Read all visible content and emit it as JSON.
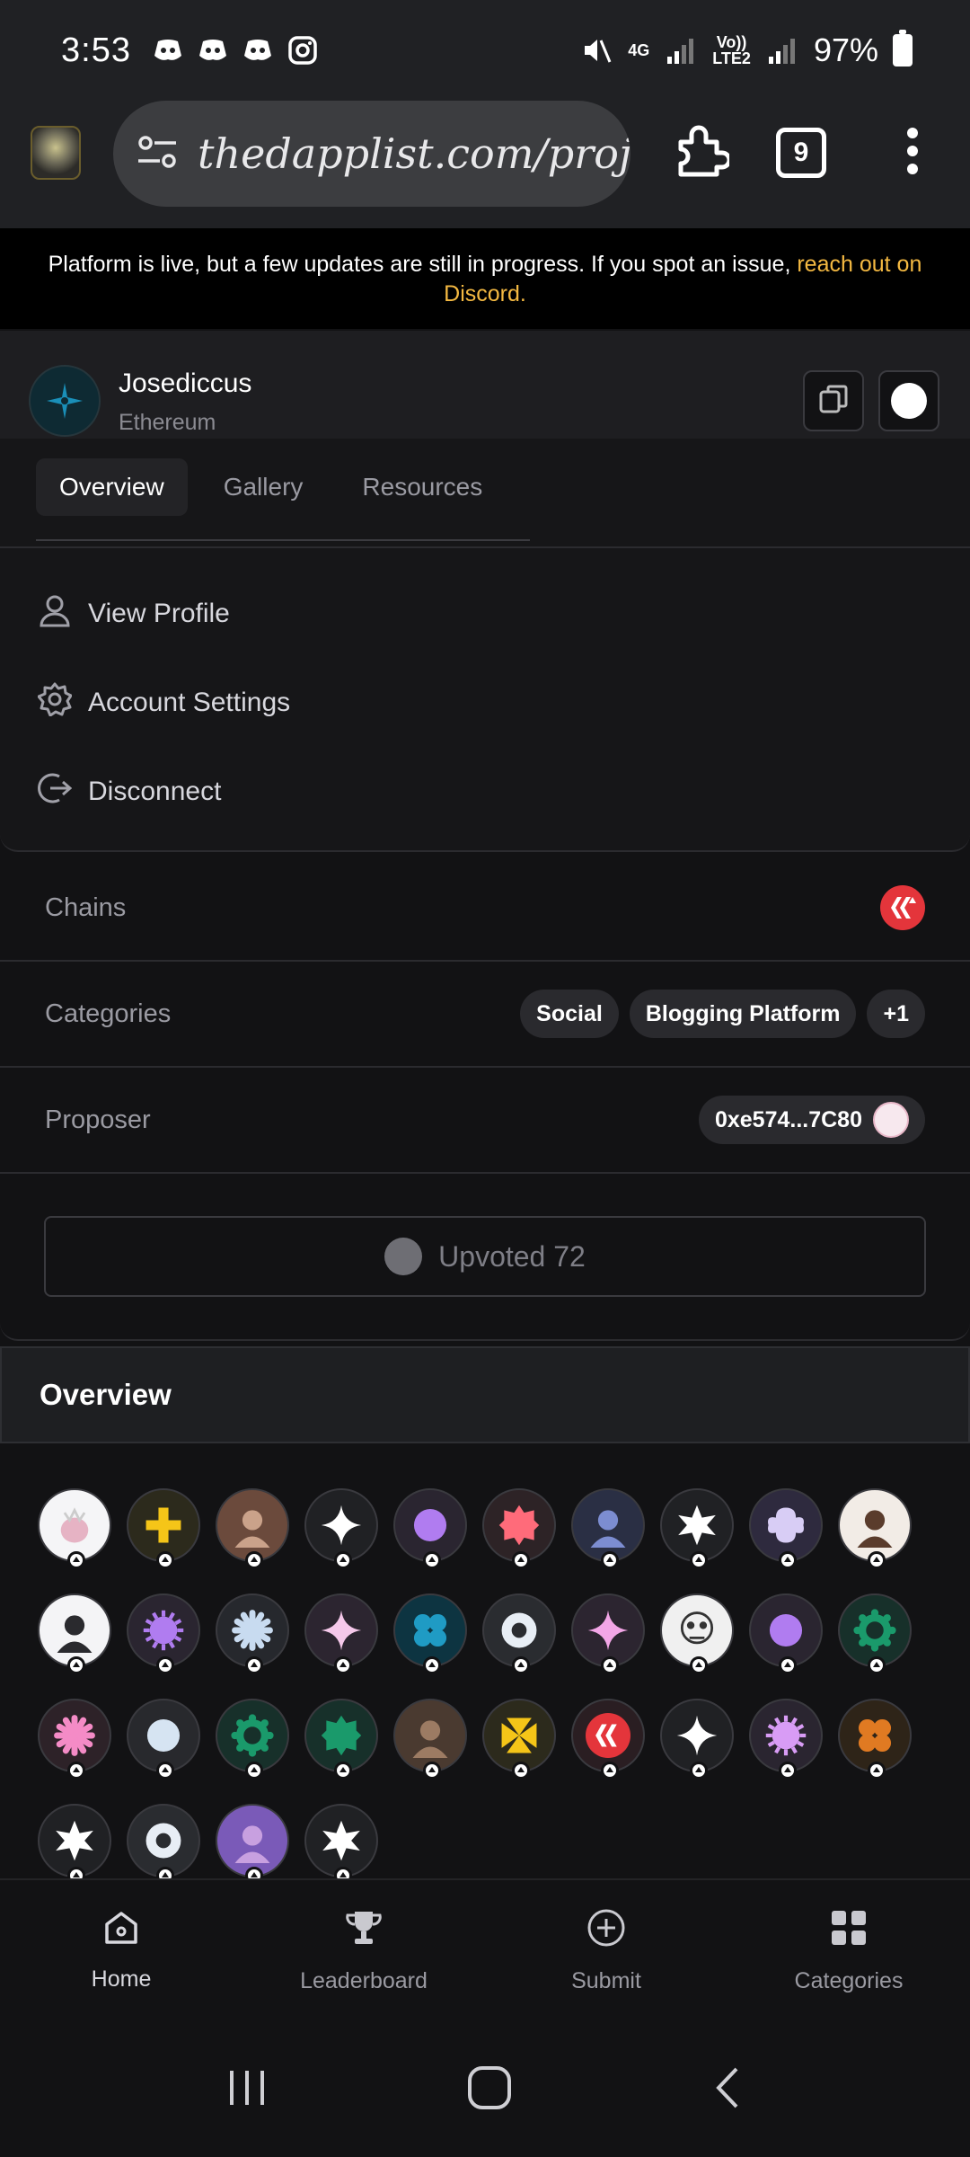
{
  "status_bar": {
    "time": "3:53",
    "network_top": "4G",
    "volte_label": "Vo))\nLTE2",
    "battery": "97%"
  },
  "browser": {
    "url": "thedapplist.com/projeс",
    "tab_count": "9"
  },
  "banner": {
    "text": "Platform is live, but a few updates are still in progress. If you spot an issue, ",
    "link": "reach out on Discord."
  },
  "profile": {
    "name": "Josediccus",
    "chain": "Ethereum",
    "tabs": [
      "Overview",
      "Gallery",
      "Resources"
    ],
    "menu": [
      "View Profile",
      "Account Settings",
      "Disconnect"
    ]
  },
  "details": {
    "chains_label": "Chains",
    "categories_label": "Categories",
    "categories": [
      "Social",
      "Blogging Platform",
      "+1"
    ],
    "proposer_label": "Proposer",
    "proposer_address": "0xe574...7C80",
    "upvote_label": "Upvoted 72"
  },
  "overview": {
    "title": "Overview",
    "voters": [
      {
        "bg": "#f5f5f7",
        "fg": "#e6b3c4",
        "shape": "creature"
      },
      {
        "bg": "#2c2a1c",
        "fg": "#f5c518",
        "shape": "plus"
      },
      {
        "bg": "#6b4a3c",
        "fg": "#caa28a",
        "shape": "photo"
      },
      {
        "bg": "#202124",
        "fg": "#ffffff",
        "shape": "star4"
      },
      {
        "bg": "#2a2530",
        "fg": "#b07cf0",
        "shape": "flower"
      },
      {
        "bg": "#2d2326",
        "fg": "#ff6b7a",
        "shape": "burst"
      },
      {
        "bg": "#2a2f44",
        "fg": "#7c8dd1",
        "shape": "photo"
      },
      {
        "bg": "#202124",
        "fg": "#ffffff",
        "shape": "star6"
      },
      {
        "bg": "#2e2a3e",
        "fg": "#d8cdf5",
        "shape": "petal"
      },
      {
        "bg": "#f2ece6",
        "fg": "#5a3c2c",
        "shape": "photo"
      },
      {
        "bg": "#f4f4f6",
        "fg": "#2a2a2e",
        "shape": "photo"
      },
      {
        "bg": "#2a2530",
        "fg": "#b07cf0",
        "shape": "sun"
      },
      {
        "bg": "#26282d",
        "fg": "#c8dbf0",
        "shape": "asterisk"
      },
      {
        "bg": "#2c2530",
        "fg": "#f5c8ea",
        "shape": "star4"
      },
      {
        "bg": "#0d3441",
        "fg": "#1f9bc4",
        "shape": "clover"
      },
      {
        "bg": "#2a2c30",
        "fg": "#e8eef5",
        "shape": "ring"
      },
      {
        "bg": "#2c2530",
        "fg": "#f2a6e6",
        "shape": "star4"
      },
      {
        "bg": "#f0f0f0",
        "fg": "#333333",
        "shape": "sketch"
      },
      {
        "bg": "#2a2530",
        "fg": "#b07cf0",
        "shape": "flower"
      },
      {
        "bg": "#17302a",
        "fg": "#1a9a6b",
        "shape": "gear"
      },
      {
        "bg": "#2d2228",
        "fg": "#f48bc6",
        "shape": "asterisk"
      },
      {
        "bg": "#28292d",
        "fg": "#d6e4f2",
        "shape": "flower"
      },
      {
        "bg": "#17302a",
        "fg": "#1a9a6b",
        "shape": "gear"
      },
      {
        "bg": "#17302a",
        "fg": "#1a9a6b",
        "shape": "burst"
      },
      {
        "bg": "#4a3a30",
        "fg": "#9c7b63",
        "shape": "photo"
      },
      {
        "bg": "#2c2a1c",
        "fg": "#f5c518",
        "shape": "pinwheel"
      },
      {
        "bg": "#2a1e22",
        "fg": "#e4353b",
        "shape": "hive"
      },
      {
        "bg": "#202124",
        "fg": "#ffffff",
        "shape": "star4"
      },
      {
        "bg": "#2a2530",
        "fg": "#d89cf5",
        "shape": "sun"
      },
      {
        "bg": "#2e2418",
        "fg": "#e07a22",
        "shape": "clover"
      },
      {
        "bg": "#202124",
        "fg": "#ffffff",
        "shape": "star6"
      },
      {
        "bg": "#2a2c30",
        "fg": "#e8eef5",
        "shape": "ring"
      },
      {
        "bg": "#7a5ab8",
        "fg": "#c8a0e0",
        "shape": "photo"
      },
      {
        "bg": "#202124",
        "fg": "#ffffff",
        "shape": "star6"
      }
    ]
  },
  "bottom_nav": {
    "items": [
      {
        "label": "Home",
        "icon": "home-icon"
      },
      {
        "label": "Leaderboard",
        "icon": "trophy-icon"
      },
      {
        "label": "Submit",
        "icon": "plus-circle-icon"
      },
      {
        "label": "Categories",
        "icon": "grid-icon"
      }
    ]
  }
}
